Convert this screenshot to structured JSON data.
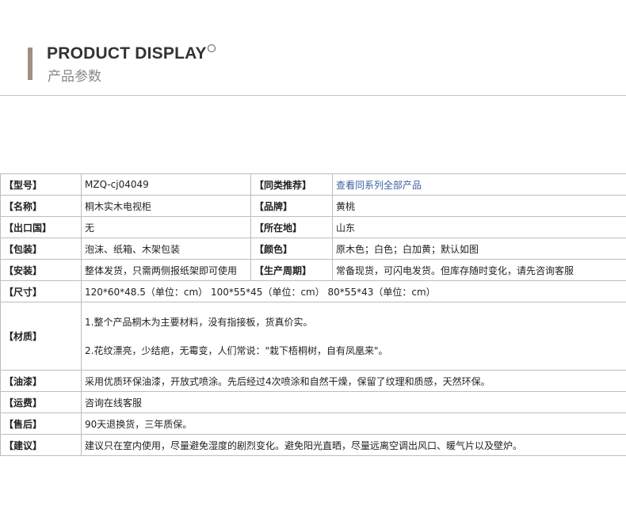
{
  "header": {
    "title_en": "PRODUCT DISPLAY",
    "title_cn": "产品参数"
  },
  "rows": {
    "model": {
      "label": "【型号】",
      "value": "MZQ-cj04049"
    },
    "similar": {
      "label": "【同类推荐】",
      "link": "查看同系列全部产品"
    },
    "name": {
      "label": "【名称】",
      "value": "桐木实木电视柜"
    },
    "brand": {
      "label": "【品牌】",
      "value": "黄桃"
    },
    "export": {
      "label": "【出口国】",
      "value": "无"
    },
    "location": {
      "label": "【所在地】",
      "value": "山东"
    },
    "packing": {
      "label": "【包装】",
      "value": "泡沫、纸箱、木架包装"
    },
    "color": {
      "label": "【颜色】",
      "value": "原木色；白色；白加黄；默认如图"
    },
    "install": {
      "label": "【安装】",
      "value": "整体发货，只需两侧报纸架即可使用"
    },
    "production": {
      "label": "【生产周期】",
      "value": "常备现货，可闪电发货。但库存随时变化，请先咨询客服"
    },
    "size": {
      "label": "【尺寸】",
      "value": "120*60*48.5（单位：cm）  100*55*45（单位：cm）  80*55*43（单位：cm）"
    },
    "material": {
      "label": "【材质】",
      "lines": [
        "1.整个产品桐木为主要材料，没有指接板，货真价实。",
        "2.花纹漂亮，少结疤，无霉变，人们常说：\"栽下梧桐树，自有凤凰来\"。"
      ]
    },
    "paint": {
      "label": "【油漆】",
      "value": "采用优质环保油漆，开放式喷涂。先后经过4次喷涂和自然干燥，保留了纹理和质感，天然环保。"
    },
    "shipping": {
      "label": "【运费】",
      "value": "咨询在线客服"
    },
    "aftersale": {
      "label": "【售后】",
      "value": "90天退换货，三年质保。"
    },
    "advice": {
      "label": "【建议】",
      "value": "建议只在室内使用，尽量避免湿度的剧烈变化。避免阳光直晒，尽量远离空调出风口、暖气片以及壁炉。"
    }
  }
}
